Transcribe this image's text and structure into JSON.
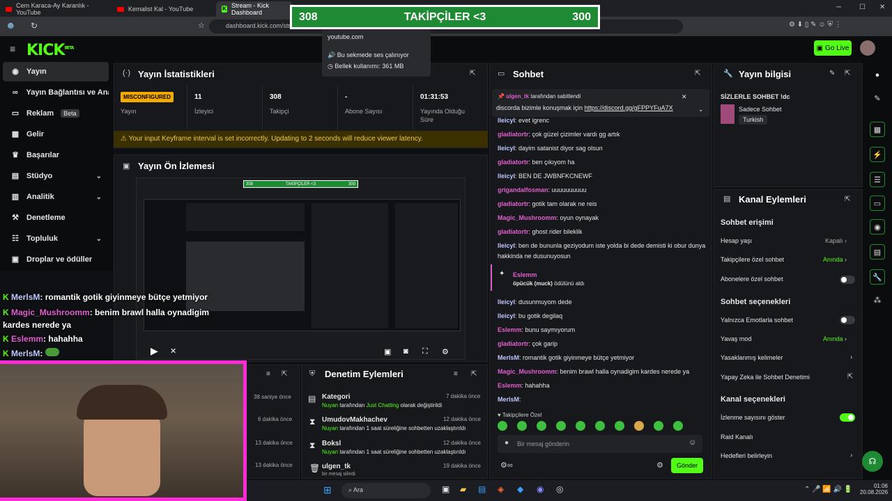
{
  "browser": {
    "tabs": [
      {
        "title": "Cem Karaca-Ay Karanlık - YouTube",
        "icon": "youtube-icon"
      },
      {
        "title": "Kemalist Kal - YouTube",
        "icon": "youtube-icon"
      },
      {
        "title": "Stream - Kick Dashboard",
        "icon": "kick-icon"
      }
    ],
    "url": "dashboard.kick.com/str",
    "tooltip": {
      "site": "youtube.com",
      "line1": "Bu sekmede ses çalınıyor",
      "line2": "Bellek kullanımı: 361 MB"
    }
  },
  "overlay": {
    "left_score": "308",
    "title": "TAKİPÇİLER <3",
    "right_score": "300"
  },
  "kick": {
    "logo": "KICK",
    "logo_sup": "BETA",
    "go_live": "Go Live"
  },
  "sidebar": {
    "items": [
      {
        "label": "Yayın",
        "icon": "broadcast-icon"
      },
      {
        "label": "Yayın Bağlantısı ve Anahtar",
        "icon": "link-icon"
      },
      {
        "label": "Reklam",
        "icon": "ad-icon",
        "badge": "Beta"
      },
      {
        "label": "Gelir",
        "icon": "revenue-icon"
      },
      {
        "label": "Başarılar",
        "icon": "trophy-icon"
      },
      {
        "label": "Stüdyo",
        "icon": "studio-icon"
      },
      {
        "label": "Analitik",
        "icon": "analytics-icon"
      },
      {
        "label": "Denetleme",
        "icon": "moderation-icon"
      },
      {
        "label": "Topluluk",
        "icon": "community-icon"
      },
      {
        "label": "Droplar ve ödüller",
        "icon": "drops-icon"
      }
    ]
  },
  "stats": {
    "title": "Yayın İstatistikleri",
    "status_badge": "MISCONFIGURED",
    "status_label": "Yayın",
    "viewers": "11",
    "viewers_label": "İzleyici",
    "followers": "308",
    "followers_label": "Takipçi",
    "subs": "-",
    "subs_label": "Abone Sayısı",
    "uptime": "01:31:53",
    "uptime_label": "Yayında Olduğu Süre",
    "warning": "Your input Keyframe interval is set incorrectly. Updating to 2 seconds will reduce viewer latency."
  },
  "preview": {
    "title": "Yayın Ön İzlemesi"
  },
  "stream_chat": [
    {
      "user": "MerlsM",
      "text": ": romantik gotik giyinmeye bütçe yetmiyor"
    },
    {
      "user": "Magic_Mushroomm",
      "text": ": benim brawl halla oynadigim kardes nerede ya"
    },
    {
      "user": "Eslemm",
      "text": ": hahahha"
    },
    {
      "user": "MerlsM",
      "text": ":"
    }
  ],
  "activity_times": [
    "38 saniye önce",
    "6 dakika önce",
    "13 dakika önce",
    "13 dakika önce"
  ],
  "moderation": {
    "title": "Denetim Eylemleri",
    "items": [
      {
        "name": "Kategori",
        "actor": "Nuyan",
        "desc_pre": " tarafından ",
        "highlight": "Just Chatting",
        "desc_post": " olarak değiştirildi",
        "time": "7 dakika önce"
      },
      {
        "name": "UmudovMakhachev",
        "actor": "Nuyan",
        "desc_pre": " tarafından 1 saat süreliğine sohbetten uzaklaştırıldı",
        "highlight": "",
        "desc_post": "",
        "time": "12 dakika önce"
      },
      {
        "name": "Boksl",
        "actor": "Nuyan",
        "desc_pre": " tarafından 1 saat süreliğine sohbetten uzaklaştırıldı",
        "highlight": "",
        "desc_post": "",
        "time": "12 dakika önce"
      },
      {
        "name": "ulgen_tk",
        "actor": "",
        "desc_pre": "bir mesaj silindi",
        "highlight": "",
        "desc_post": "",
        "time": "19 dakika önce"
      }
    ]
  },
  "chat": {
    "title": "Sohbet",
    "pinned_by": "ulgen_tk",
    "pinned_suffix": "tarafından sabitlendi",
    "pinned_text": "discorda bizimle konuşmak için ",
    "pinned_link": "https://discord.gg/gFPPYFuA7X",
    "messages": [
      {
        "user": "lleicyl",
        "text": ": evet igrenc",
        "color": "bl"
      },
      {
        "user": "gladiatortr",
        "text": ": çok güzel çizimler vardı gg artık",
        "color": "gr"
      },
      {
        "user": "lleicyl",
        "text": ": dayim satanist diyor sag olsun",
        "color": "bl"
      },
      {
        "user": "gladiatortr",
        "text": ": ben çıkıyom ha",
        "color": "gr"
      },
      {
        "user": "lleicyl",
        "text": ": BEN DE JWBNFKCNEWF",
        "color": "bl"
      },
      {
        "user": "grigandalfosman",
        "text": ": uuuuuuuuuu",
        "color": "pk"
      },
      {
        "user": "gladiatortr",
        "text": ": gotik tam olarak ne reis",
        "color": "gr"
      },
      {
        "user": "Magic_Mushroomm",
        "text": ": oyun oynayak",
        "color": "pk"
      },
      {
        "user": "gladiatortr",
        "text": ": ghost rider bileklik",
        "color": "gr"
      },
      {
        "user": "lleicyl",
        "text": ": ben de bununla geziyodum iste yolda bi dede demisti ki obur dunya hakkinda ne dusunuyosun",
        "color": "bl"
      }
    ],
    "reward_user": "Eslemm",
    "reward_text": "öpücük (muck)",
    "reward_suffix": " ödülünü aldı",
    "messages2": [
      {
        "user": "lleicyl",
        "text": ": dusunmuyom dede",
        "color": "bl"
      },
      {
        "user": "lleicyl",
        "text": ": bu gotik degilaq",
        "color": "bl"
      },
      {
        "user": "Eslemm",
        "text": ": bunu saymıyorum",
        "color": "pk"
      },
      {
        "user": "gladiatortr",
        "text": ": çok garip",
        "color": "gr"
      },
      {
        "user": "MerlsM",
        "text": ": romantik gotik giyinmeye bütçe yetmiyor",
        "color": "bl"
      },
      {
        "user": "Magic_Mushroomm",
        "text": ": benim brawl halla oynadigim kardes nerede ya",
        "color": "pk"
      },
      {
        "user": "Eslemm",
        "text": ": hahahha",
        "color": "pk"
      },
      {
        "user": "MerlsM",
        "text": ":",
        "color": "bl"
      }
    ],
    "emote_label": "Takipçilere Özel",
    "input_placeholder": "Bir mesaj gönderin",
    "send": "Gönder"
  },
  "stream_info": {
    "title": "Yayın bilgisi",
    "stream_title": "SİZLERLE SOHBET !dc",
    "category": "Sadece Sohbet",
    "tag": "Turkish"
  },
  "channel_actions": {
    "title": "Kanal Eylemleri",
    "section1": "Sohbet erişimi",
    "account_age": "Hesap yaşı",
    "account_age_val": "Kapalı",
    "follower_chat": "Takipçilere özel sohbet",
    "follower_chat_val": "Anında",
    "sub_chat": "Abonelere özel sohbet",
    "section2": "Sohbet seçenekleri",
    "emote_only": "Yalnızca Emotlarla sohbet",
    "slow_mode": "Yavaş mod",
    "slow_mode_val": "Anında",
    "banned_words": "Yasaklanmış kelimeler",
    "ai_mod": "Yapay Zeka ile Sohbet Denetimi",
    "section3": "Kanal seçenekleri",
    "show_viewers": "İzlenme sayısını göster",
    "raid": "Raid Kanalı",
    "goals": "Hedefleri belirleyin"
  },
  "taskbar": {
    "search": "Ara",
    "time": "01:06",
    "date": "20.08.2026"
  },
  "colors": {
    "accent": "#53fc18",
    "pink": "#ff2bd6",
    "warning": "#f2a900"
  }
}
